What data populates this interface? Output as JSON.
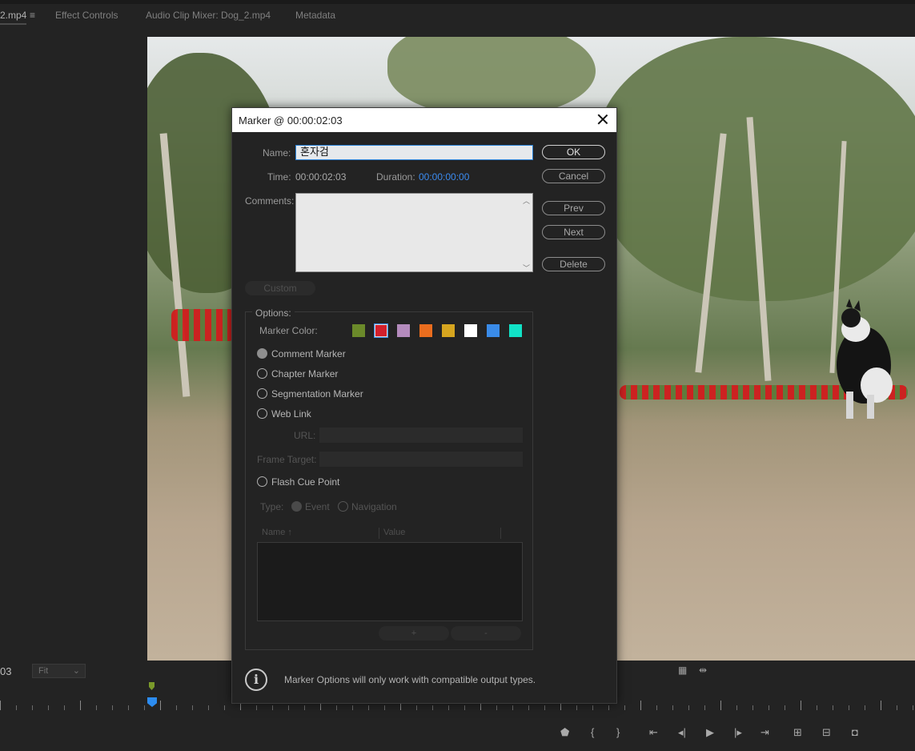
{
  "tabs": [
    {
      "label": "2.mp4"
    },
    {
      "label": "Effect Controls"
    },
    {
      "label": "Audio Clip Mixer: Dog_2.mp4"
    },
    {
      "label": "Metadata"
    }
  ],
  "monitor": {
    "timecode": "03",
    "zoom": "Fit"
  },
  "dialog": {
    "title": "Marker @ 00:00:02:03",
    "name_label": "Name:",
    "name_value": "혼자검",
    "time_label": "Time:",
    "time_value": "00:00:02:03",
    "duration_label": "Duration:",
    "duration_value": "00:00:00:00",
    "comments_label": "Comments:",
    "buttons": {
      "ok": "OK",
      "cancel": "Cancel",
      "prev": "Prev",
      "next": "Next",
      "delete": "Delete",
      "custom": "Custom"
    },
    "options": {
      "title": "Options:",
      "marker_color_label": "Marker Color:",
      "colors": [
        "#6b8a2a",
        "#d21f2c",
        "#b48bbd",
        "#ea6d1e",
        "#d6a51f",
        "#ffffff",
        "#3a8be8",
        "#11e2c6"
      ],
      "selected_color_index": 1,
      "radios": [
        {
          "label": "Comment Marker",
          "checked": true
        },
        {
          "label": "Chapter Marker",
          "checked": false
        },
        {
          "label": "Segmentation Marker",
          "checked": false
        },
        {
          "label": "Web Link",
          "checked": false
        }
      ],
      "url_label": "URL:",
      "frame_target_label": "Frame Target:",
      "flash_cue_label": "Flash Cue Point",
      "type_label": "Type:",
      "type_event": "Event",
      "type_navigation": "Navigation",
      "table_name_col": "Name",
      "table_value_col": "Value",
      "add_param": "+",
      "remove_param": "-"
    },
    "footer_text": "Marker Options will only work with compatible output types."
  }
}
